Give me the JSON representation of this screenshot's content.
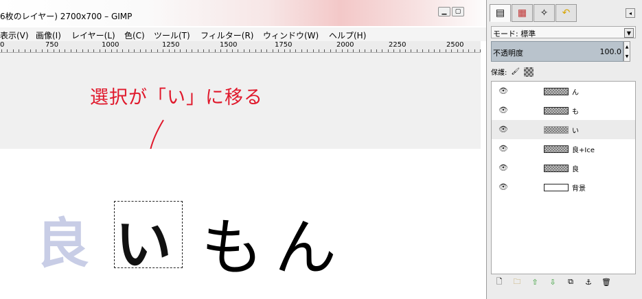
{
  "window": {
    "title": "6枚のレイヤー) 2700x700 – GIMP",
    "buttons": [
      "▁",
      "▢",
      "✕"
    ]
  },
  "menu": [
    "表示(V)",
    "画像(I)",
    "レイヤー(L)",
    "色(C)",
    "ツール(T)",
    "フィルター(R)",
    "ウィンドウ(W)",
    "ヘルプ(H)"
  ],
  "ruler": {
    "labels": [
      "0",
      "750",
      "1000",
      "1250",
      "1500",
      "1750",
      "2000",
      "2250",
      "2500"
    ]
  },
  "canvas": {
    "annotation": "選択が「い」に移る",
    "glyphs": [
      "良",
      "い",
      "も",
      "ん"
    ]
  },
  "dock": {
    "tab_icons": [
      "layers-icon",
      "channels-icon",
      "paths-icon",
      "undo-icon"
    ],
    "mode_label": "モード:",
    "mode_value": "標準",
    "opacity_label": "不透明度",
    "opacity_value": "100.0",
    "lock_label": "保護:",
    "layers": [
      {
        "name": "ん",
        "selected": false
      },
      {
        "name": "も",
        "selected": false
      },
      {
        "name": "い",
        "selected": true
      },
      {
        "name": "良+Ice",
        "selected": false
      },
      {
        "name": "良",
        "selected": false
      },
      {
        "name": "背景",
        "selected": false
      }
    ],
    "bottom_icons": [
      "new-layer-icon",
      "new-group-icon",
      "raise-layer-icon",
      "lower-layer-icon",
      "duplicate-layer-icon",
      "anchor-icon",
      "delete-layer-icon"
    ]
  },
  "colors": {
    "annotation": "#e0182b",
    "opacity_bar": "#b9c3cc",
    "ghost_glyph": "#c8cde6"
  }
}
